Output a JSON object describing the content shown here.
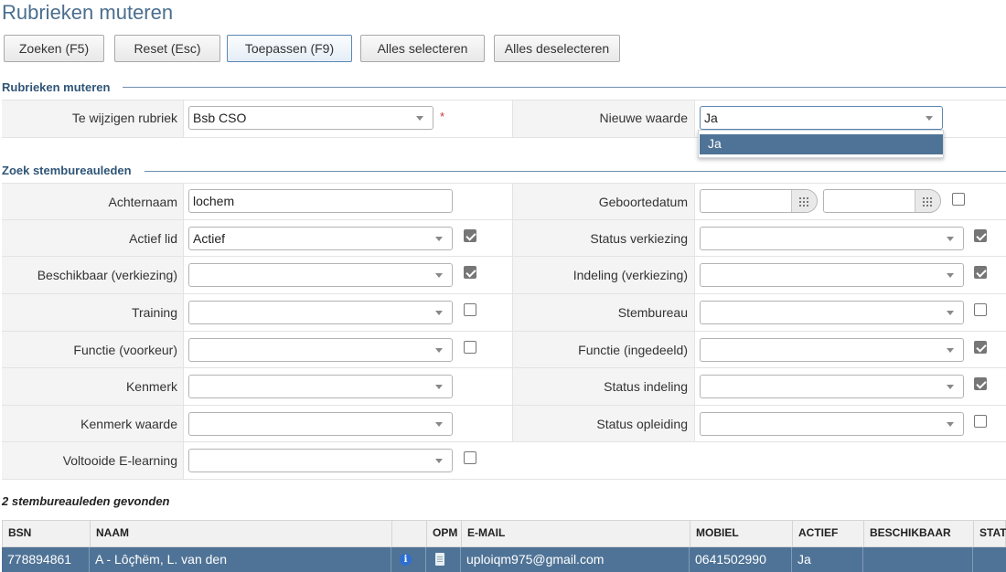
{
  "page": {
    "title": "Rubrieken muteren"
  },
  "toolbar": {
    "search": "Zoeken (F5)",
    "reset": "Reset (Esc)",
    "apply": "Toepassen (F9)",
    "select_all": "Alles selecteren",
    "deselect_all": "Alles deselecteren"
  },
  "mutate_section": {
    "title": "Rubrieken muteren",
    "rubric_label": "Te wijzigen rubriek",
    "rubric_value": "Bsb CSO",
    "required_mark": "*",
    "new_value_label": "Nieuwe waarde",
    "new_value": "Ja",
    "dropdown_options": [
      "Ja"
    ]
  },
  "search_section": {
    "title": "Zoek stembureauleden",
    "fields": {
      "achternaam": {
        "label": "Achternaam",
        "value": "lochem"
      },
      "geboortedatum": {
        "label": "Geboortedatum",
        "checked": false
      },
      "actief": {
        "label": "Actief lid",
        "value": "Actief",
        "checked": true
      },
      "status_verk": {
        "label": "Status verkiezing",
        "value": "",
        "checked": true
      },
      "beschikbaar": {
        "label": "Beschikbaar (verkiezing)",
        "value": "",
        "checked": true
      },
      "indeling": {
        "label": "Indeling (verkiezing)",
        "value": "",
        "checked": true
      },
      "training": {
        "label": "Training",
        "value": "",
        "checked": false
      },
      "stembureau": {
        "label": "Stembureau",
        "value": "",
        "checked": false
      },
      "functie_vk": {
        "label": "Functie (voorkeur)",
        "value": "",
        "checked": false
      },
      "functie_ig": {
        "label": "Functie (ingedeeld)",
        "value": "",
        "checked": true
      },
      "kenmerk": {
        "label": "Kenmerk",
        "value": ""
      },
      "status_ind": {
        "label": "Status indeling",
        "value": "",
        "checked": true
      },
      "kenmerk_w": {
        "label": "Kenmerk waarde",
        "value": ""
      },
      "status_opl": {
        "label": "Status opleiding",
        "value": "",
        "checked": false
      },
      "elearning": {
        "label": "Voltooide E-learning",
        "value": "",
        "checked": false
      }
    }
  },
  "results": {
    "count_text": "2 stembureauleden gevonden",
    "columns": [
      "BSN",
      "NAAM",
      "",
      "OPM",
      "E-MAIL",
      "MOBIEL",
      "ACTIEF",
      "BESCHIKBAAR",
      "STAT"
    ],
    "rows": [
      {
        "bsn": "778894861",
        "naam": "A - Lôçħëm, L. van den",
        "email": "uploiqm975@gmail.com",
        "mobiel": "0641502990",
        "actief": "Ja",
        "beschikbaar": ""
      }
    ]
  },
  "colors": {
    "accent": "#4f7396",
    "title": "#4a6e8f",
    "required": "#d0343a"
  }
}
